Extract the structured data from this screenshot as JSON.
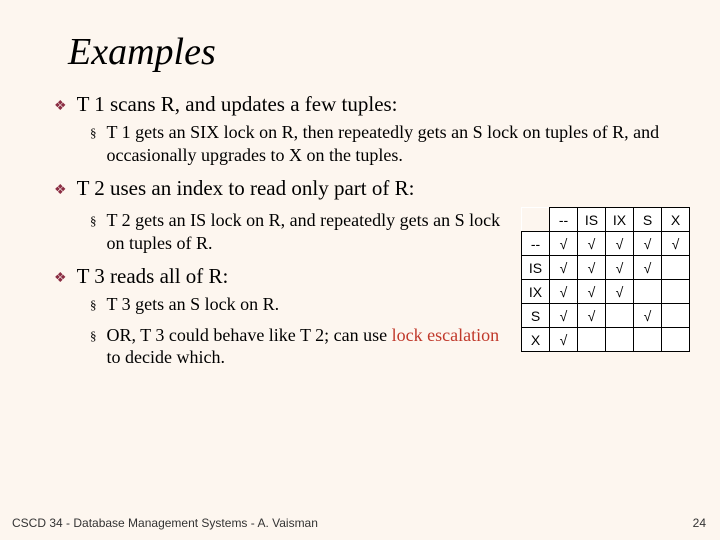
{
  "title": "Examples",
  "bullets": {
    "b1": {
      "text": "T 1 scans R, and updates a few tuples:",
      "sub1": "T 1 gets an SIX lock on R, then repeatedly gets an S lock on tuples of R, and occasionally upgrades to X on the tuples."
    },
    "b2": {
      "text": "T 2 uses an index to read only part of R:",
      "sub1": "T 2 gets an IS lock on R, and repeatedly gets an S lock on tuples of R."
    },
    "b3": {
      "text": "T 3 reads all of R:",
      "sub1": "T 3 gets an S lock on R.",
      "sub2_a": "OR, T 3 could behave like T 2; can use ",
      "sub2_hl": "lock escalation",
      "sub2_b": " to decide which."
    }
  },
  "table": {
    "cols": [
      "--",
      "IS",
      "IX",
      "S",
      "X"
    ],
    "rows": [
      "--",
      "IS",
      "IX",
      "S",
      "X"
    ],
    "check": "√",
    "cells": [
      [
        "y",
        "y",
        "y",
        "y",
        "y"
      ],
      [
        "y",
        "y",
        "y",
        "y",
        ""
      ],
      [
        "y",
        "y",
        "y",
        "",
        ""
      ],
      [
        "y",
        "y",
        "",
        "y",
        ""
      ],
      [
        "y",
        "",
        "",
        "",
        ""
      ]
    ]
  },
  "footer": {
    "left": "CSCD 34 - Database Management Systems - A. Vaisman",
    "right": "24"
  }
}
